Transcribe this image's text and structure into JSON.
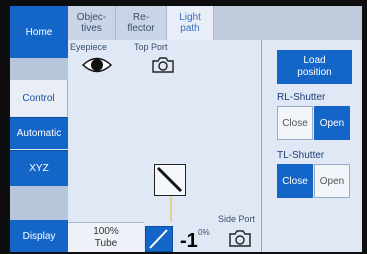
{
  "sidebar": {
    "home": "Home",
    "control": "Control",
    "automatic": "Automatic",
    "xyz": "XYZ",
    "display": "Display"
  },
  "tabs": {
    "objectives": [
      "Objec-",
      "tives"
    ],
    "reflector": [
      "Re-",
      "flector"
    ],
    "light_path": [
      "Light",
      "path"
    ]
  },
  "light_path": {
    "eyepiece": "Eyepiece",
    "top_port": "Top Port",
    "side_port": "Side Port",
    "tube_percent": "100%",
    "tube_label": "Tube",
    "side_percent": "0%"
  },
  "overlay_number": "-1",
  "right_panel": {
    "load_position": [
      "Load",
      "position"
    ],
    "rl_shutter": "RL-Shutter",
    "tl_shutter": "TL-Shutter",
    "close": "Close",
    "open": "Open",
    "rl_state": "open",
    "tl_state": "close"
  },
  "colors": {
    "accent": "#1465c8",
    "background": "#dde6f2"
  }
}
